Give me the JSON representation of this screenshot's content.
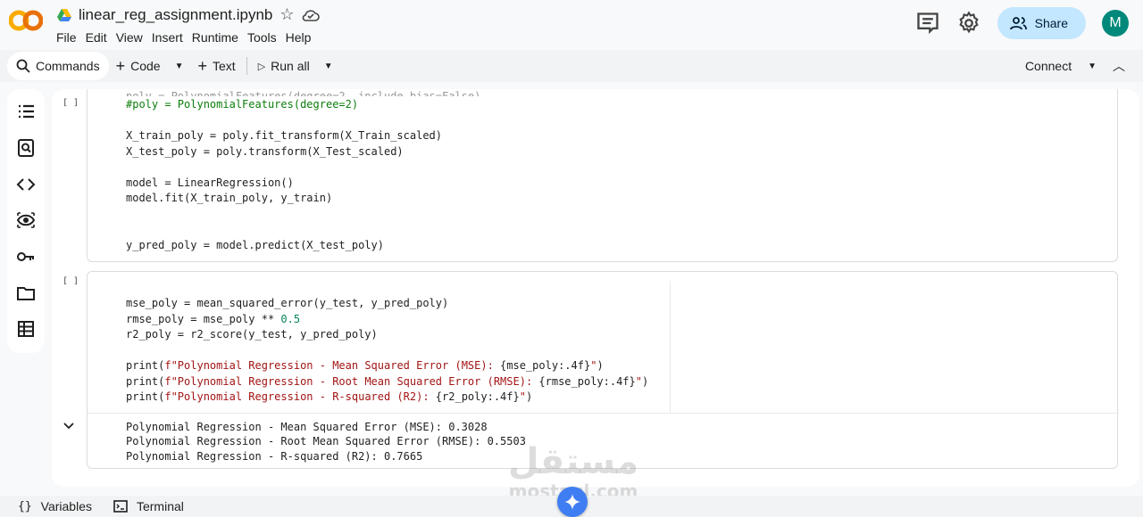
{
  "header": {
    "filename": "linear_reg_assignment.ipynb",
    "menu": [
      "File",
      "Edit",
      "View",
      "Insert",
      "Runtime",
      "Tools",
      "Help"
    ],
    "share_label": "Share",
    "avatar_letter": "M"
  },
  "toolbar": {
    "commands": "Commands",
    "code": "Code",
    "text": "Text",
    "run_all": "Run all",
    "connect": "Connect"
  },
  "cells": [
    {
      "bracket": "[ ]",
      "lines": [
        {
          "t": "#poly = PolynomialFeatures(degree=2)",
          "k": "cm"
        },
        {
          "t": "",
          "k": ""
        },
        {
          "t": "X_train_poly = poly.fit_transform(X_Train_scaled)",
          "k": ""
        },
        {
          "t": "X_test_poly = poly.transform(X_Test_scaled)",
          "k": ""
        },
        {
          "t": "",
          "k": ""
        },
        {
          "t": "model = LinearRegression()",
          "k": ""
        },
        {
          "t": "model.fit(X_train_poly, y_train)",
          "k": ""
        },
        {
          "t": "",
          "k": ""
        },
        {
          "t": "",
          "k": ""
        },
        {
          "t": "y_pred_poly = model.predict(X_test_poly)",
          "k": ""
        }
      ]
    },
    {
      "bracket": "[ ]",
      "lines": [
        {
          "t": "mse_poly = mean_squared_error(y_test, y_pred_poly)",
          "k": ""
        },
        {
          "t": "rmse_poly = mse_poly ** 0.5",
          "k": ""
        },
        {
          "t": "r2_poly = r2_score(y_test, y_pred_poly)",
          "k": ""
        },
        {
          "t": "",
          "k": ""
        },
        {
          "t": "print(f\"Polynomial Regression - Mean Squared Error (MSE): {mse_poly:.4f}\")",
          "k": "pr"
        },
        {
          "t": "print(f\"Polynomial Regression - Root Mean Squared Error (RMSE): {rmse_poly:.4f}\")",
          "k": "pr"
        },
        {
          "t": "print(f\"Polynomial Regression - R-squared (R2): {r2_poly:.4f}\")",
          "k": "pr"
        }
      ],
      "output": [
        "Polynomial Regression - Mean Squared Error (MSE): 0.3028",
        "Polynomial Regression - Root Mean Squared Error (RMSE): 0.5503",
        "Polynomial Regression - R-squared (R2): 0.7665"
      ]
    }
  ],
  "statusbar": {
    "variables": "Variables",
    "terminal": "Terminal"
  },
  "watermark": {
    "main": "مستقل",
    "sub": "mostaql.com"
  }
}
